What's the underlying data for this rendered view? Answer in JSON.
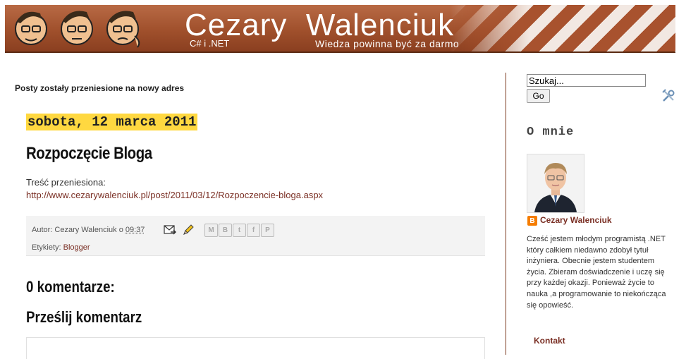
{
  "header": {
    "site_title": "Cezary  Walenciuk",
    "tagline_left": "C# i .NET",
    "tagline_right": "Wiedza powinna być za darmo"
  },
  "main": {
    "moved_note": "Posty zostały przeniesione na nowy adres",
    "date_header": "sobota, 12 marca 2011",
    "post": {
      "title": "Rozpoczęcie Bloga",
      "body_text": "Treść przeniesiona:",
      "link": "http://www.cezarywalenciuk.pl/post/2011/03/12/Rozpoczencie-bloga.aspx",
      "author_prefix": "Autor: Cezary Walenciuk o",
      "time": "09:37",
      "labels_prefix": "Etykiety:",
      "label": "Blogger"
    },
    "share_buttons": [
      "M",
      "B",
      "t",
      "f",
      "P"
    ],
    "comments_heading": "0 komentarze:",
    "post_comment_heading": "Prześlij komentarz"
  },
  "sidebar": {
    "search_placeholder": "Szukaj...",
    "search_button": "Go",
    "about_heading": "O mnie",
    "profile_name": "Cezary Walenciuk",
    "bio": "Cześć jestem młodym programistą .NET który całkiem niedawno zdobył tytuł inżyniera. Obecnie jestem studentem życia. Zbieram doświadczenie i uczę się przy każdej okazji. Ponieważ życie to nauka ,a programowanie to niekończąca się opowieść.",
    "contact_heading": "Kontakt"
  },
  "colors": {
    "accent": "#7a2f24",
    "date_highlight": "#ffd840",
    "banner": "#a0502c"
  }
}
